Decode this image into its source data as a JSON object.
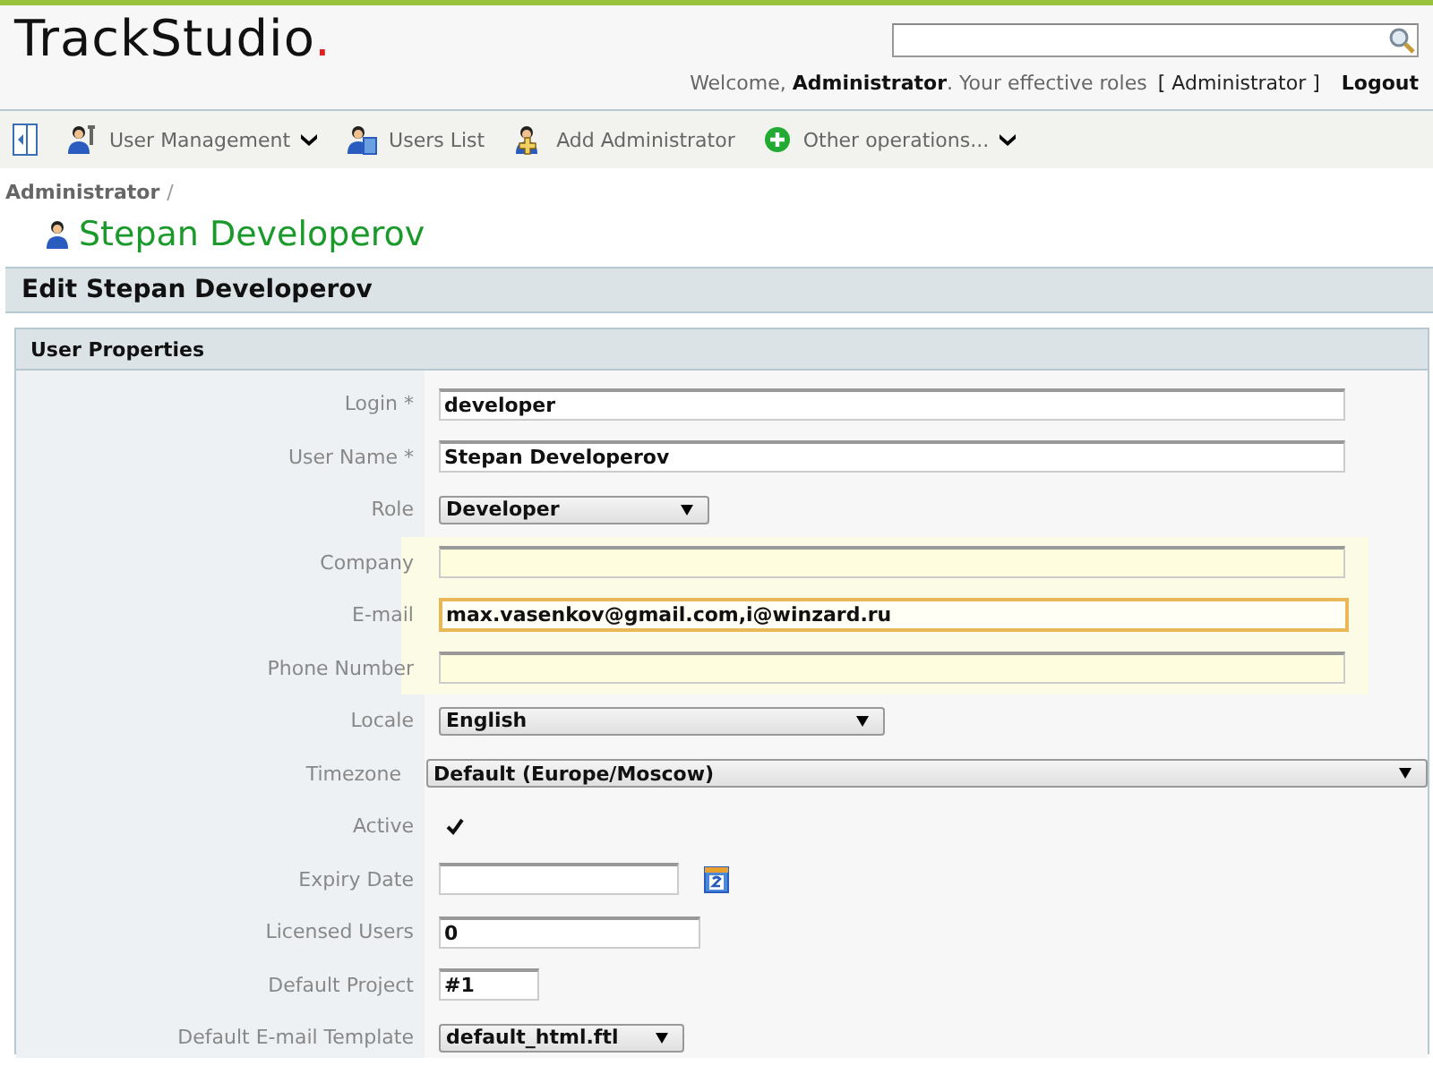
{
  "header": {
    "logo": {
      "name": "TrackStudio",
      "mark": "."
    },
    "welcome": {
      "prefix": "Welcome,",
      "user": "Administrator",
      "suffix": ". Your effective roles",
      "roles": "[ Administrator ]",
      "logout": "Logout"
    }
  },
  "toolbar": [
    {
      "label": "User Management",
      "kind": "menu"
    },
    {
      "label": "Users List",
      "kind": "link"
    },
    {
      "label": "Add Administrator",
      "kind": "link"
    },
    {
      "label": "Other operations...",
      "kind": "menu"
    }
  ],
  "breadcrumb": {
    "items": [
      "Administrator"
    ],
    "separator": "/"
  },
  "page_title": "Stepan Developerov",
  "panel_title": "Edit Stepan Developerov",
  "section_title": "User Properties",
  "fields": [
    {
      "label": "Login *",
      "kind": "text",
      "value": "developer",
      "highlighted": false,
      "focused": false
    },
    {
      "label": "User Name *",
      "kind": "text",
      "value": "Stepan Developerov",
      "highlighted": false,
      "focused": false
    },
    {
      "label": "Role",
      "kind": "select",
      "value": "Developer"
    },
    {
      "label": "Company",
      "kind": "text",
      "highlighted": true,
      "focused": false
    },
    {
      "label": "E-mail",
      "kind": "text",
      "value": "max.vasenkov@gmail.com,i@winzard.ru",
      "highlighted": true,
      "focused": true
    },
    {
      "label": "Phone Number",
      "kind": "text",
      "highlighted": true,
      "focused": false
    },
    {
      "label": "Locale",
      "kind": "select",
      "value": "English"
    },
    {
      "label": "Timezone",
      "kind": "select",
      "value": "Default (Europe/Moscow)"
    },
    {
      "label": "Active",
      "kind": "checkbox",
      "checked": true
    },
    {
      "label": "Expiry Date",
      "kind": "date",
      "highlighted": false,
      "focused": false
    },
    {
      "label": "Licensed Users",
      "kind": "text",
      "value": "0",
      "highlighted": false,
      "focused": false
    },
    {
      "label": "Default Project",
      "kind": "text",
      "value": "#1",
      "highlighted": false,
      "focused": false
    },
    {
      "label": "Default E-mail Template",
      "kind": "select",
      "value": "default_html.ftl"
    }
  ]
}
